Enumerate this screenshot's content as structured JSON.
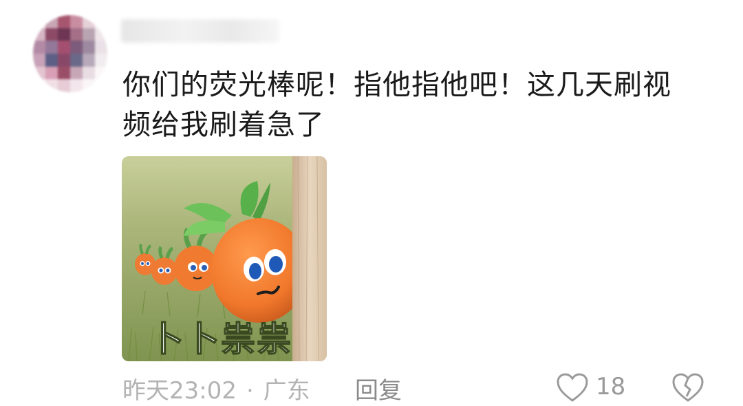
{
  "comment": {
    "username": "",
    "text_line1": "你们的荧光棒呢！指他指他吧！这几天刷视",
    "text_line2": "频给我刷着急了",
    "sticker": {
      "caption": "卜卜祟祟"
    },
    "meta": {
      "time": "昨天23:02",
      "separator": "·",
      "location": "广东",
      "reply_label": "回复"
    },
    "likes": "18"
  },
  "colors": {
    "text": "#1a1a1a",
    "meta": "#b3b3b3",
    "carrot": "#f07a2e",
    "leaf": "#5cb84a",
    "grass": "#8fa35c"
  },
  "icons": {
    "like": "heart-icon",
    "dislike": "broken-heart-icon"
  }
}
